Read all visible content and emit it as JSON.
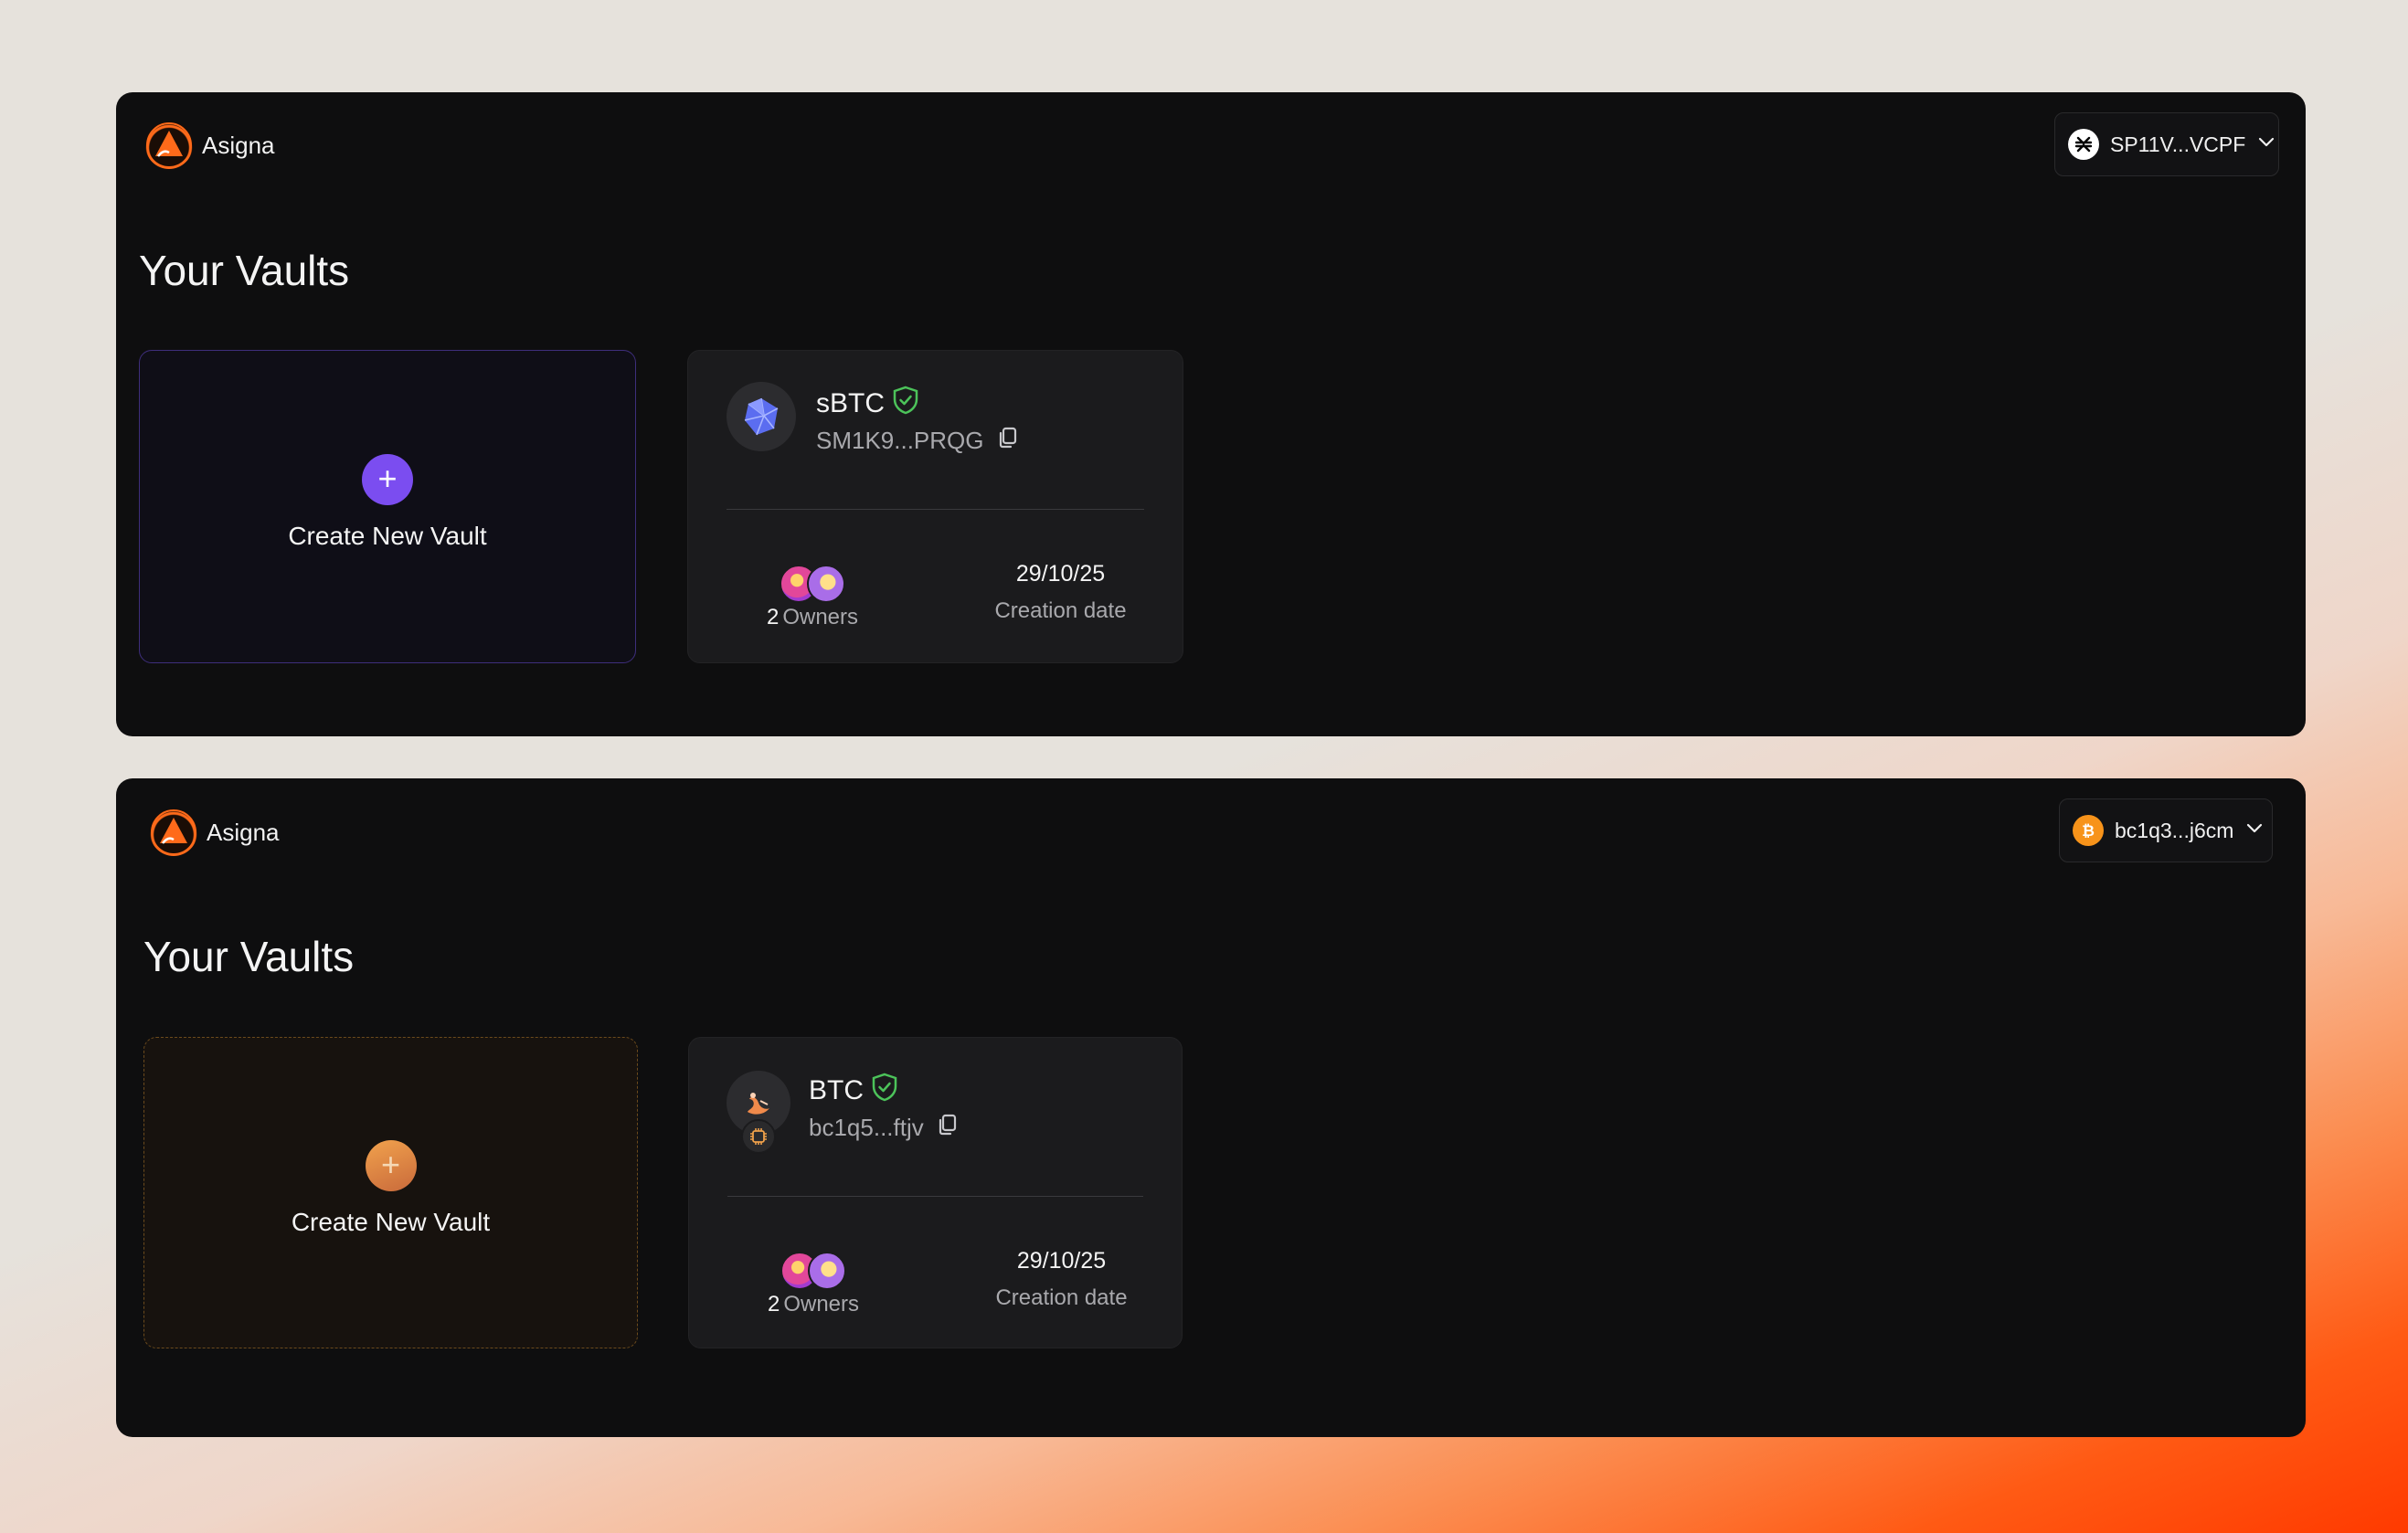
{
  "panels": [
    {
      "logo_text": "Asigna",
      "wallet": {
        "address": "SP11V...VCPF",
        "icon": "stacks-icon"
      },
      "title": "Your Vaults",
      "create_label": "Create New Vault",
      "create_icon": "+",
      "accent": "#7b4df0",
      "vault": {
        "name": "sBTC",
        "address": "SM1K9...PRQG",
        "owners_count": "2",
        "owners_label": "Owners",
        "created_date": "29/10/25",
        "created_label": "Creation date"
      }
    },
    {
      "logo_text": "Asigna",
      "wallet": {
        "address": "bc1q3...j6cm",
        "icon": "bitcoin-icon"
      },
      "title": "Your Vaults",
      "create_label": "Create New Vault",
      "create_icon": "+",
      "accent": "#f1a24d",
      "vault": {
        "name": "BTC",
        "address": "bc1q5...ftjv",
        "owners_count": "2",
        "owners_label": "Owners",
        "created_date": "29/10/25",
        "created_label": "Creation date"
      }
    }
  ]
}
